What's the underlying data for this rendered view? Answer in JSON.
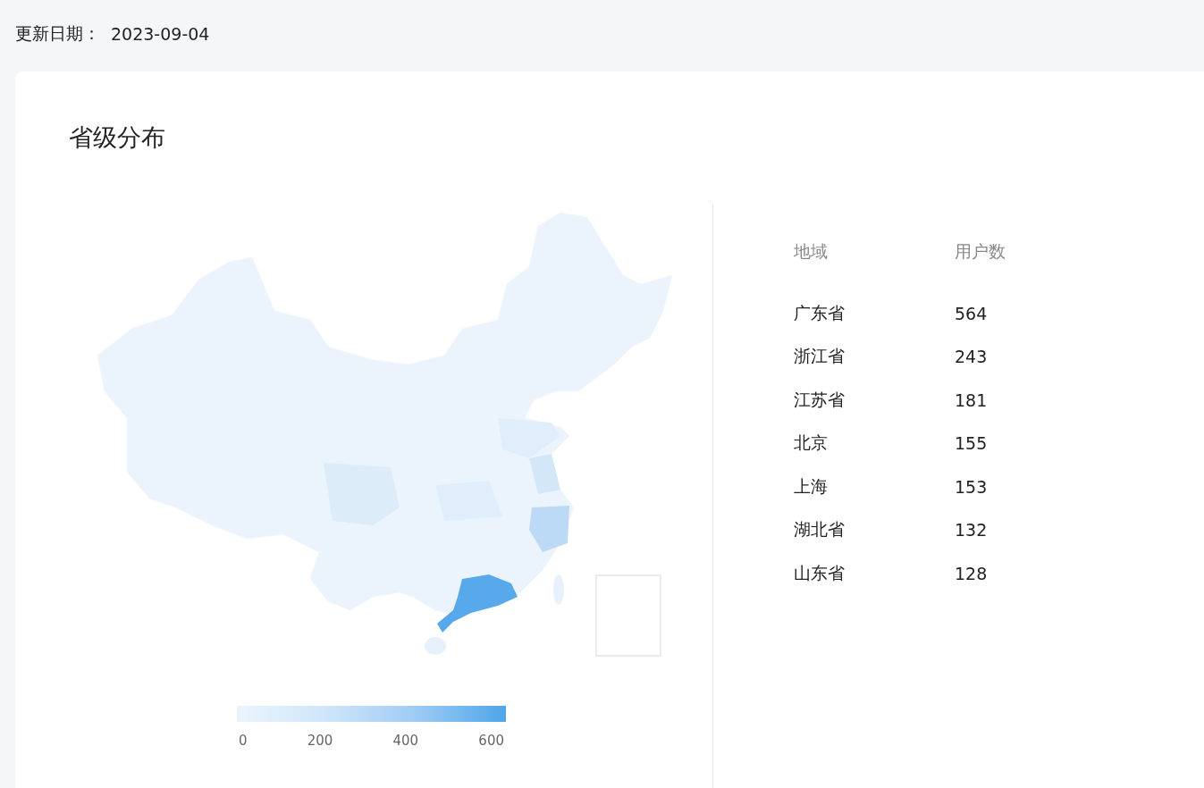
{
  "update": {
    "label": "更新日期：",
    "date": "2023-09-04"
  },
  "card": {
    "title": "省级分布"
  },
  "legend": {
    "labels": [
      "0",
      "200",
      "400",
      "600"
    ]
  },
  "table": {
    "columns": [
      "地域",
      "用户数"
    ],
    "rows": [
      [
        "广东省",
        "564"
      ],
      [
        "浙江省",
        "243"
      ],
      [
        "江苏省",
        "181"
      ],
      [
        "北京",
        "155"
      ],
      [
        "上海",
        "153"
      ],
      [
        "湖北省",
        "132"
      ],
      [
        "山东省",
        "128"
      ]
    ]
  }
}
